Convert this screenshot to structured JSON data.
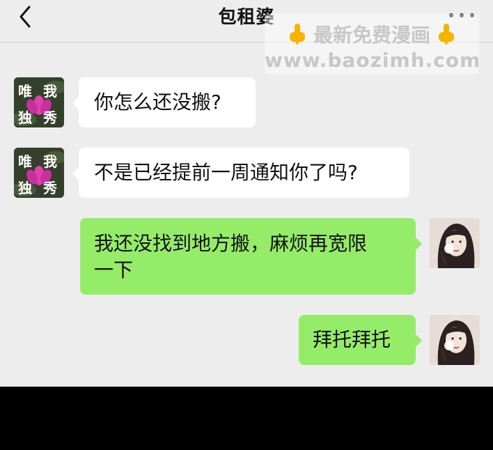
{
  "header": {
    "title": "包租婆",
    "back_icon": "chevron-left-icon",
    "more_icon": "more-dots-icon"
  },
  "watermark": {
    "line1": "最新免费漫画",
    "line2": "www.baozimh.com",
    "icon": "pointing-down-hand-icon"
  },
  "contact_avatar": {
    "chars": [
      "唯",
      "我",
      "独",
      "秀"
    ],
    "icon": "lotus-icon"
  },
  "messages": [
    {
      "side": "in",
      "text": "你怎么还没搬?"
    },
    {
      "side": "in",
      "text": "不是已经提前一周通知你了吗?"
    },
    {
      "side": "out",
      "line1": "我还没找到地方搬，麻烦再宽限",
      "line2": "一下"
    },
    {
      "side": "out",
      "text": "拜托拜托"
    }
  ],
  "colors": {
    "background": "#ededed",
    "incoming_bubble": "#ffffff",
    "outgoing_bubble": "#95ec69",
    "bottom_bar": "#000000"
  }
}
